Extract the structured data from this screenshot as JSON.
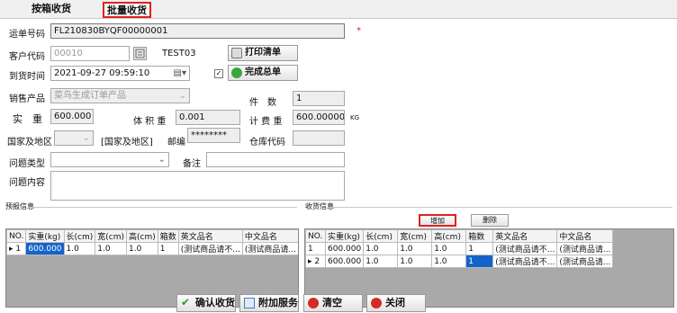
{
  "tabs": {
    "inactive": "按箱收货",
    "active": "批量收货"
  },
  "form": {
    "waybill_label": "运单号码",
    "waybill_value": "FL210830BYQF00000001",
    "required_mark": "*",
    "customer_label": "客户代码",
    "customer_code": "00010",
    "customer_name": "TEST03",
    "print_button": "打印清单",
    "arrival_label": "到货时间",
    "arrival_value": "2021-09-27 09:59:10",
    "complete_button": "完成总单",
    "product_label": "销售产品",
    "product_value": "菜鸟生成订单产品",
    "pieces_label": "件　数",
    "pieces_value": "1",
    "weight_label": "实　重",
    "weight_value": "600.000",
    "volume_label": "体 积 重",
    "volume_value": "0.001",
    "charge_label": "计 费 重",
    "charge_value": "600.000000",
    "kg_unit": "KG",
    "country_label": "国家及地区",
    "country_bracket": "[国家及地区]",
    "postcode_label": "邮编",
    "postcode_value": "********",
    "warehouse_label": "仓库代码",
    "warehouse_value": "",
    "issue_type_label": "问题类型",
    "issue_type_value": "",
    "remark_label": "备注",
    "remark_value": "",
    "issue_content_label": "问题内容",
    "issue_content_value": ""
  },
  "prediction": {
    "title": "预报信息",
    "headers": [
      "NO.",
      "实重(kg)",
      "长(cm)",
      "宽(cm)",
      "高(cm)",
      "箱数",
      "英文品名",
      "中文品名"
    ],
    "rows": [
      {
        "marker": "▸",
        "no": "1",
        "weight": "600.000",
        "length": "1.0",
        "width": "1.0",
        "height": "1.0",
        "boxes": "1",
        "en_name": "(测试商品请不...",
        "cn_name": "(测试商品请..."
      }
    ]
  },
  "receiving": {
    "title": "收货信息",
    "add_button": "增加",
    "delete_button": "删除",
    "headers": [
      "NO.",
      "实重(kg)",
      "长(cm)",
      "宽(cm)",
      "高(cm)",
      "箱数",
      "英文品名",
      "中文品名"
    ],
    "rows": [
      {
        "marker": "",
        "no": "1",
        "weight": "600.000",
        "length": "1.0",
        "width": "1.0",
        "height": "1.0",
        "boxes": "1",
        "en_name": "(测试商品请不...",
        "cn_name": "(测试商品请..."
      },
      {
        "marker": "▸",
        "no": "2",
        "weight": "600.000",
        "length": "1.0",
        "width": "1.0",
        "height": "1.0",
        "boxes": "1",
        "en_name": "(测试商品请不...",
        "cn_name": "(测试商品请..."
      }
    ]
  },
  "footer": {
    "confirm_button": "确认收货",
    "addon_button": "附加服务",
    "clear_button": "清空",
    "close_button": "关闭"
  },
  "colors": {
    "highlight_red": "#e02020",
    "selection_blue": "#1464c8",
    "grid_backdrop": "#a9a9a9"
  }
}
